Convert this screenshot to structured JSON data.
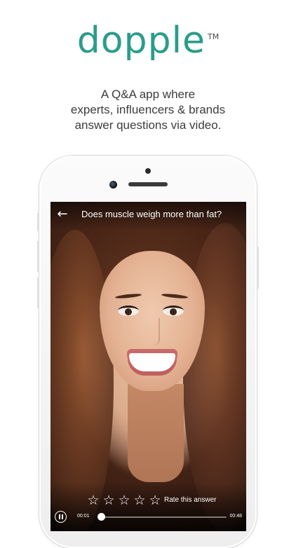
{
  "brand": {
    "name": "dopple",
    "trademark": "TM"
  },
  "tagline": [
    "A Q&A app where",
    "experts, influencers & brands",
    "answer questions via video."
  ],
  "colors": {
    "brand": "#2a9d8a",
    "phone_body": "#f4f4f4",
    "overlay_text": "#ffffff"
  },
  "video_screen": {
    "back_icon": "back-arrow-icon",
    "back_glyph": "←",
    "question": "Does muscle weigh more than fat?",
    "rating": {
      "stars": [
        "☆",
        "☆",
        "☆",
        "☆",
        "☆"
      ],
      "star_icon": "star-outline-icon",
      "filled": 0,
      "label": "Rate this answer"
    },
    "player": {
      "state_icon": "pause-icon",
      "current_time": "00:01",
      "total_time": "00:48",
      "progress": 0.02
    }
  }
}
